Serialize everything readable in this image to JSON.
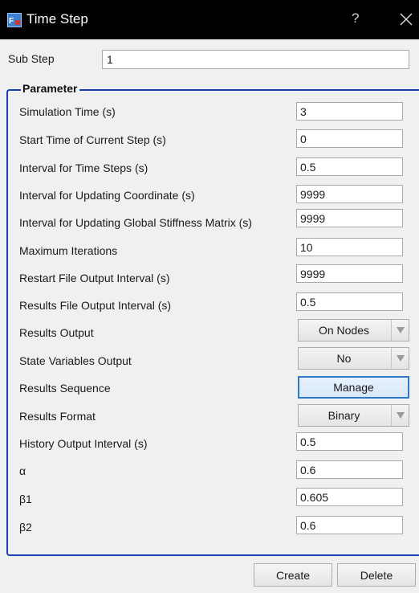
{
  "window": {
    "title": "Time Step",
    "help": "?"
  },
  "substep": {
    "label": "Sub Step",
    "value": "1"
  },
  "group_title": "Parameter",
  "params": {
    "simulation_time": {
      "label": "Simulation Time (s)",
      "value": "3"
    },
    "start_time": {
      "label": "Start Time of Current Step (s)",
      "value": "0"
    },
    "interval_time_steps": {
      "label": "Interval for Time Steps (s)",
      "value": "0.5"
    },
    "interval_coordinate": {
      "label": "Interval for Updating Coordinate (s)",
      "value": "9999"
    },
    "interval_stiffness": {
      "label": "Interval for Updating Global Stiffness Matrix (s)",
      "value": "9999"
    },
    "max_iterations": {
      "label": "Maximum Iterations",
      "value": "10"
    },
    "restart_output": {
      "label": "Restart File Output Interval (s)",
      "value": "9999"
    },
    "results_file_output": {
      "label": "Results File Output Interval (s)",
      "value": "0.5"
    },
    "results_output": {
      "label": "Results Output",
      "value": "On Nodes"
    },
    "state_variables": {
      "label": "State Variables Output",
      "value": "No"
    },
    "results_sequence": {
      "label": "Results Sequence",
      "button": "Manage"
    },
    "results_format": {
      "label": "Results Format",
      "value": "Binary"
    },
    "history_output": {
      "label": "History Output Interval (s)",
      "value": "0.5"
    },
    "alpha": {
      "label": "α",
      "value": "0.6"
    },
    "beta1": {
      "label": "β1",
      "value": "0.605"
    },
    "beta2": {
      "label": "β2",
      "value": "0.6"
    }
  },
  "footer": {
    "create": "Create",
    "delete": "Delete"
  },
  "icons": {
    "app": "fes-app-icon",
    "close": "close-icon",
    "dropdown": "dropdown-arrow-icon"
  },
  "colors": {
    "titlebar": "#000000",
    "group_border": "#1a3fb0",
    "focus_border": "#2d79c7",
    "background": "#f0f0f0"
  }
}
